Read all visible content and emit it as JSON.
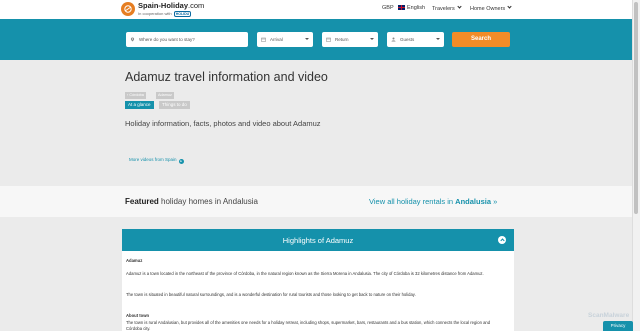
{
  "header": {
    "logo_title": "Spain-Holiday",
    "logo_suffix": ".com",
    "logo_subtitle": "In cooperation with",
    "partner": "HOLIDU",
    "currency": "GBP",
    "language": "English",
    "menu_travelers": "Travelers",
    "menu_owners": "Home Owners"
  },
  "search": {
    "where_placeholder": "Where do you want to stay?",
    "arrival": "Arrival",
    "return": "Return",
    "guests": "Guests",
    "button": "Search"
  },
  "page": {
    "title": "Adamuz travel information and video",
    "breadcrumbs": [
      "‹ Córdoba",
      "Adamuz"
    ],
    "tabs": [
      "At a glance",
      "Things to do"
    ],
    "subtitle": "Holiday information, facts, photos and video about Adamuz",
    "more_videos": "More videos from Spain"
  },
  "featured": {
    "title_bold": "Featured",
    "title_rest": " holiday homes in Andalusia",
    "view_all_prefix": "View all holiday rentals in ",
    "view_all_region": "Andalusia",
    "view_all_suffix": " »"
  },
  "highlights": {
    "title": "Highlights of Adamuz",
    "heading1": "Adamuz",
    "para1": "Adamuz is a town located in the northeast of the province of Córdoba, in the natural region known as the Sierra Morena in Andalusia. The city of Córdoba is 32 kilometres distance from Adamuz.",
    "para2": "The town is situated in beautiful natural surroundings, and is a wonderful destination for rural tourists and those looking to get back to nature on their holiday.",
    "heading2": "About town",
    "para3": "The town is rural Andalusian, but provides all of the amenities one needs for a holiday retreat, including shops, supermarket, bars, restaurants and a bus station, which connects the local region and Córdoba city."
  },
  "badges": {
    "scanmalware": "ScanMalware",
    "privacy": "Privacy"
  },
  "colors": {
    "teal": "#1591ab",
    "orange": "#f28c28",
    "logo_orange": "#e67e22"
  }
}
